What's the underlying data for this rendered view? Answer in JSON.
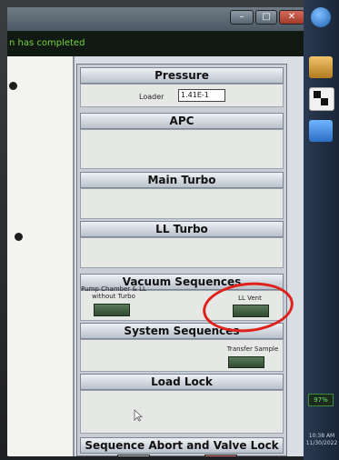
{
  "notice": {
    "text": "n has completed"
  },
  "window_buttons": {
    "minimize": "–",
    "maximize": "□",
    "close": "✕"
  },
  "sections": {
    "pressure": {
      "title": "Pressure",
      "loader_label": "Loader",
      "loader_value": "1.41E-1"
    },
    "apc": {
      "title": "APC"
    },
    "main_turbo": {
      "title": "Main Turbo"
    },
    "ll_turbo": {
      "title": "LL Turbo"
    },
    "vacuum_sequences": {
      "title": "Vacuum Sequences",
      "pump_chamber_label": "Pump Chamber & LL without Turbo",
      "ll_vent_label": "LL Vent"
    },
    "system_sequences": {
      "title": "System Sequences",
      "transfer_sample_label": "Transfer Sample"
    },
    "load_lock": {
      "title": "Load Lock"
    },
    "sequence_abort": {
      "title": "Sequence Abort and Valve Lock"
    }
  },
  "taskbar": {
    "battery": "97%",
    "clock_time": "10:38 AM",
    "clock_date": "11/30/2022"
  },
  "colors": {
    "annotation": "#e0201a",
    "seq_button": "#2f4a30",
    "notice_text": "#79d13f"
  }
}
